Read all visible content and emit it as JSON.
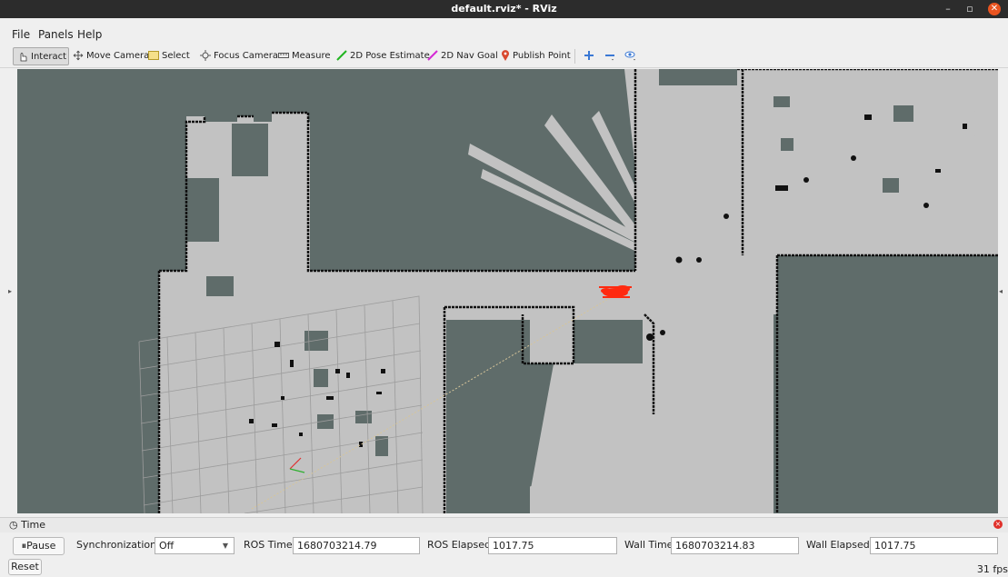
{
  "window": {
    "title": "default.rviz* - RViz",
    "minimize_glyph": "–",
    "maximize_glyph": "▫",
    "close_glyph": "✕"
  },
  "menu": {
    "items": [
      "File",
      "Panels",
      "Help"
    ]
  },
  "toolbar": {
    "tools": [
      {
        "label": "Interact",
        "icon": "hand-pointer-icon",
        "active": true
      },
      {
        "label": "Move Camera",
        "icon": "move-camera-icon",
        "active": false
      },
      {
        "label": "Select",
        "icon": "select-box-icon",
        "active": false
      },
      {
        "label": "Focus Camera",
        "icon": "focus-camera-icon",
        "active": false
      },
      {
        "label": "Measure",
        "icon": "ruler-icon",
        "active": false
      },
      {
        "label": "2D Pose Estimate",
        "icon": "green-arrow-icon",
        "active": false
      },
      {
        "label": "2D Nav Goal",
        "icon": "magenta-arrow-icon",
        "active": false
      },
      {
        "label": "Publish Point",
        "icon": "map-pin-icon",
        "active": false
      }
    ],
    "extra_icons": [
      "add-tool-icon",
      "remove-tool-icon",
      "view-options-icon"
    ]
  },
  "colors": {
    "unknown_space": "#5f6c6a",
    "free_space": "#c2c2c2",
    "obstacle": "#111111",
    "grid": "#9c9c9c",
    "particles": "#ff2a10",
    "pose_green": "#21b521",
    "goal_magenta": "#d42ad4",
    "pin_red": "#d9492f",
    "accent_orange": "#e95420"
  },
  "time_panel": {
    "title": "Time",
    "pause_label": "Pause",
    "sync_label": "Synchronization:",
    "sync_value": "Off",
    "ros_time_label": "ROS Time:",
    "ros_time_value": "1680703214.79",
    "ros_elapsed_label": "ROS Elapsed:",
    "ros_elapsed_value": "1017.75",
    "wall_time_label": "Wall Time:",
    "wall_time_value": "1680703214.83",
    "wall_elapsed_label": "Wall Elapsed:",
    "wall_elapsed_value": "1017.75"
  },
  "status": {
    "reset_label": "Reset",
    "fps": "31 fps"
  }
}
